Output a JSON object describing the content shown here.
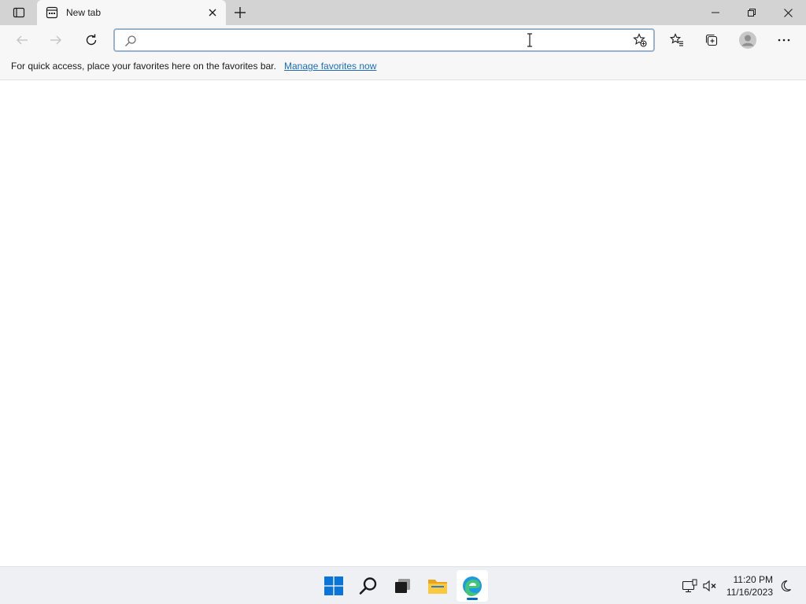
{
  "browser": {
    "tab": {
      "title": "New tab",
      "favicon": "new-tab-icon"
    },
    "window_controls": [
      "minimize-icon",
      "restore-icon",
      "close-icon"
    ]
  },
  "toolbar": {
    "back_icon": "arrow-left-icon",
    "forward_icon": "arrow-right-icon",
    "refresh_icon": "refresh-icon",
    "address": {
      "value": "",
      "placeholder": ""
    },
    "right_icons": [
      "favorites-icon",
      "collections-icon",
      "profile-avatar",
      "more-icon"
    ]
  },
  "favorites_bar": {
    "message": "For quick access, place your favorites here on the favorites bar.",
    "link": "Manage favorites now"
  },
  "taskbar": {
    "apps": [
      "start-icon",
      "search-icon",
      "task-view-icon",
      "file-explorer-icon",
      "edge-icon"
    ],
    "clock": {
      "time": "11:20 PM",
      "date": "11/16/2023"
    }
  },
  "colors": {
    "accent": "#0067c0",
    "link": "#1a6cc1",
    "titlebar": "#d3d3d3",
    "toolbar": "#f7f7f7"
  }
}
